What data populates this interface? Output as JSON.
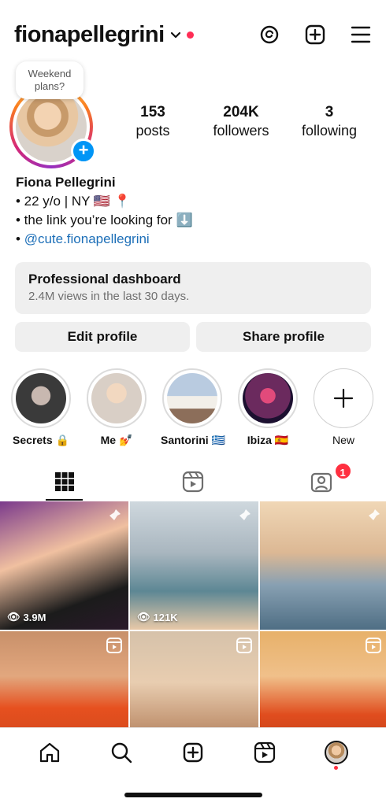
{
  "header": {
    "username": "fionapellegrini",
    "icons": [
      "chevron-down-icon",
      "threads-icon",
      "plus-square-icon",
      "menu-icon"
    ]
  },
  "profile": {
    "note": "Weekend plans?",
    "stats": [
      {
        "value": "153",
        "label": "posts"
      },
      {
        "value": "204K",
        "label": "followers"
      },
      {
        "value": "3",
        "label": "following"
      }
    ],
    "name": "Fiona Pellegrini",
    "bio_lines": [
      "• 22 y/o | NY 🇺🇸 📍",
      "• the link you’re looking for ⬇️"
    ],
    "bio_link_prefix": "• ",
    "bio_link": "@cute.fionapellegrini"
  },
  "dashboard": {
    "title": "Professional dashboard",
    "subtitle": "2.4M views in the last 30 days."
  },
  "buttons": {
    "edit": "Edit profile",
    "share": "Share profile"
  },
  "highlights": [
    {
      "label": "Secrets 🔒",
      "color": "#3a3a3a"
    },
    {
      "label": "Me 💅",
      "color": "#d9cfc6"
    },
    {
      "label": "Santorini 🇬🇷",
      "color": "#8fa7c3"
    },
    {
      "label": "Ibiza 🇪🇸",
      "color": "#6b2a5e"
    },
    {
      "label": "New",
      "color": "#ffffff"
    }
  ],
  "tabs": {
    "tagged_badge": "1"
  },
  "grid": [
    {
      "views": "3.9M",
      "pinned": true,
      "color_top": "#5a2d6e",
      "color_bottom": "#1b1b2a"
    },
    {
      "views": "121K",
      "pinned": true,
      "color_top": "#c9d3da",
      "color_bottom": "#5d8794"
    },
    {
      "views": "",
      "pinned": true,
      "color_top": "#e9c9a4",
      "color_bottom": "#6f8ea4"
    },
    {
      "views": "",
      "reel": true,
      "color_top": "#d89a6a",
      "color_bottom": "#e6501f"
    },
    {
      "views": "",
      "reel": true,
      "color_top": "#d8c3aa",
      "color_bottom": "#b07a52"
    },
    {
      "views": "",
      "reel": true,
      "color_top": "#e7b16a",
      "color_bottom": "#e04d1e"
    }
  ],
  "colors": {
    "accent_blue": "#0095f6",
    "link_blue": "#1d6fb8",
    "badge_red": "#ff3040"
  }
}
